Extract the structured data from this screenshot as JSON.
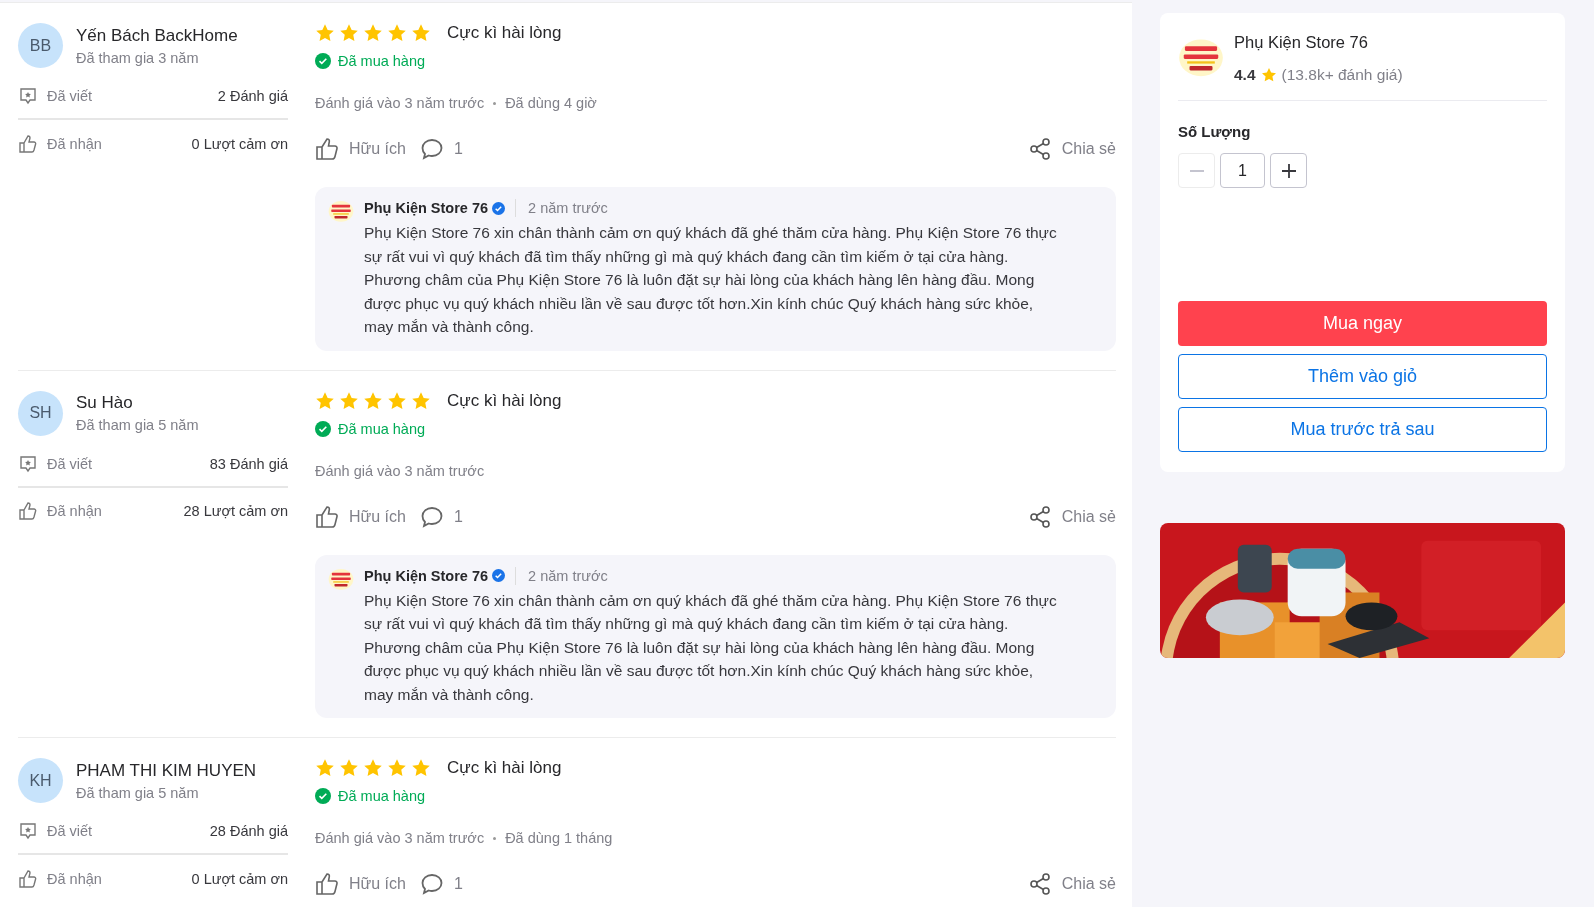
{
  "reviews": [
    {
      "avatar": "BB",
      "name": "Yến Bách BackHome",
      "joined": "Đã tham gia 3 năm",
      "written_label": "Đã viết",
      "written_value": "2 Đánh giá",
      "received_label": "Đã nhận",
      "received_value": "0 Lượt cảm ơn",
      "stars": 5,
      "title": "Cực kì hài lòng",
      "purchased": "Đã mua hàng",
      "reviewed": "Đánh giá vào 3 năm trước",
      "used": "Đã dùng 4 giờ",
      "helpful": "Hữu ích",
      "comments": "1",
      "share": "Chia sẻ",
      "reply": {
        "shop": "Phụ Kiện Store 76",
        "time": "2 năm trước",
        "text": "Phụ Kiện Store 76 xin chân thành cảm ơn quý khách đã ghé thăm cửa hàng. Phụ Kiện Store 76 thực sự rất vui vì quý khách đã tìm thấy những gì mà quý khách đang cần tìm kiếm ở tại cửa hàng. Phương châm của Phụ Kiện Store 76 là luôn đặt sự hài lòng của khách hàng lên hàng đầu. Mong được phục vụ quý khách nhiều lần về sau được tốt hơn.Xin kính chúc Quý khách hàng sức khỏe, may mắn và thành công."
      }
    },
    {
      "avatar": "SH",
      "name": "Su Hào",
      "joined": "Đã tham gia 5 năm",
      "written_label": "Đã viết",
      "written_value": "83 Đánh giá",
      "received_label": "Đã nhận",
      "received_value": "28 Lượt cảm ơn",
      "stars": 5,
      "title": "Cực kì hài lòng",
      "purchased": "Đã mua hàng",
      "reviewed": "Đánh giá vào 3 năm trước",
      "helpful": "Hữu ích",
      "comments": "1",
      "share": "Chia sẻ",
      "reply": {
        "shop": "Phụ Kiện Store 76",
        "time": "2 năm trước",
        "text": "Phụ Kiện Store 76 xin chân thành cảm ơn quý khách đã ghé thăm cửa hàng. Phụ Kiện Store 76 thực sự rất vui vì quý khách đã tìm thấy những gì mà quý khách đang cần tìm kiếm ở tại cửa hàng. Phương châm của Phụ Kiện Store 76 là luôn đặt sự hài lòng của khách hàng lên hàng đầu. Mong được phục vụ quý khách nhiều lần về sau được tốt hơn.Xin kính chúc Quý khách hàng sức khỏe, may mắn và thành công."
      }
    },
    {
      "avatar": "KH",
      "name": "PHAM THI KIM HUYEN",
      "joined": "Đã tham gia 5 năm",
      "written_label": "Đã viết",
      "written_value": "28 Đánh giá",
      "received_label": "Đã nhận",
      "received_value": "0 Lượt cảm ơn",
      "stars": 5,
      "title": "Cực kì hài lòng",
      "purchased": "Đã mua hàng",
      "reviewed": "Đánh giá vào 3 năm trước",
      "used": "Đã dùng 1 tháng",
      "helpful": "Hữu ích",
      "comments": "1",
      "share": "Chia sẻ"
    }
  ],
  "seller": {
    "name": "Phụ Kiện Store 76",
    "rating": "4.4",
    "count": "(13.8k+ đánh giá)"
  },
  "quantity": {
    "label": "Số Lượng",
    "value": "1",
    "minus_disabled": true
  },
  "buttons": [
    {
      "label": "Mua ngay",
      "kind": "primary"
    },
    {
      "label": "Thêm vào giỏ",
      "kind": "outline"
    },
    {
      "label": "Mua trước trả sau",
      "kind": "outline"
    }
  ]
}
